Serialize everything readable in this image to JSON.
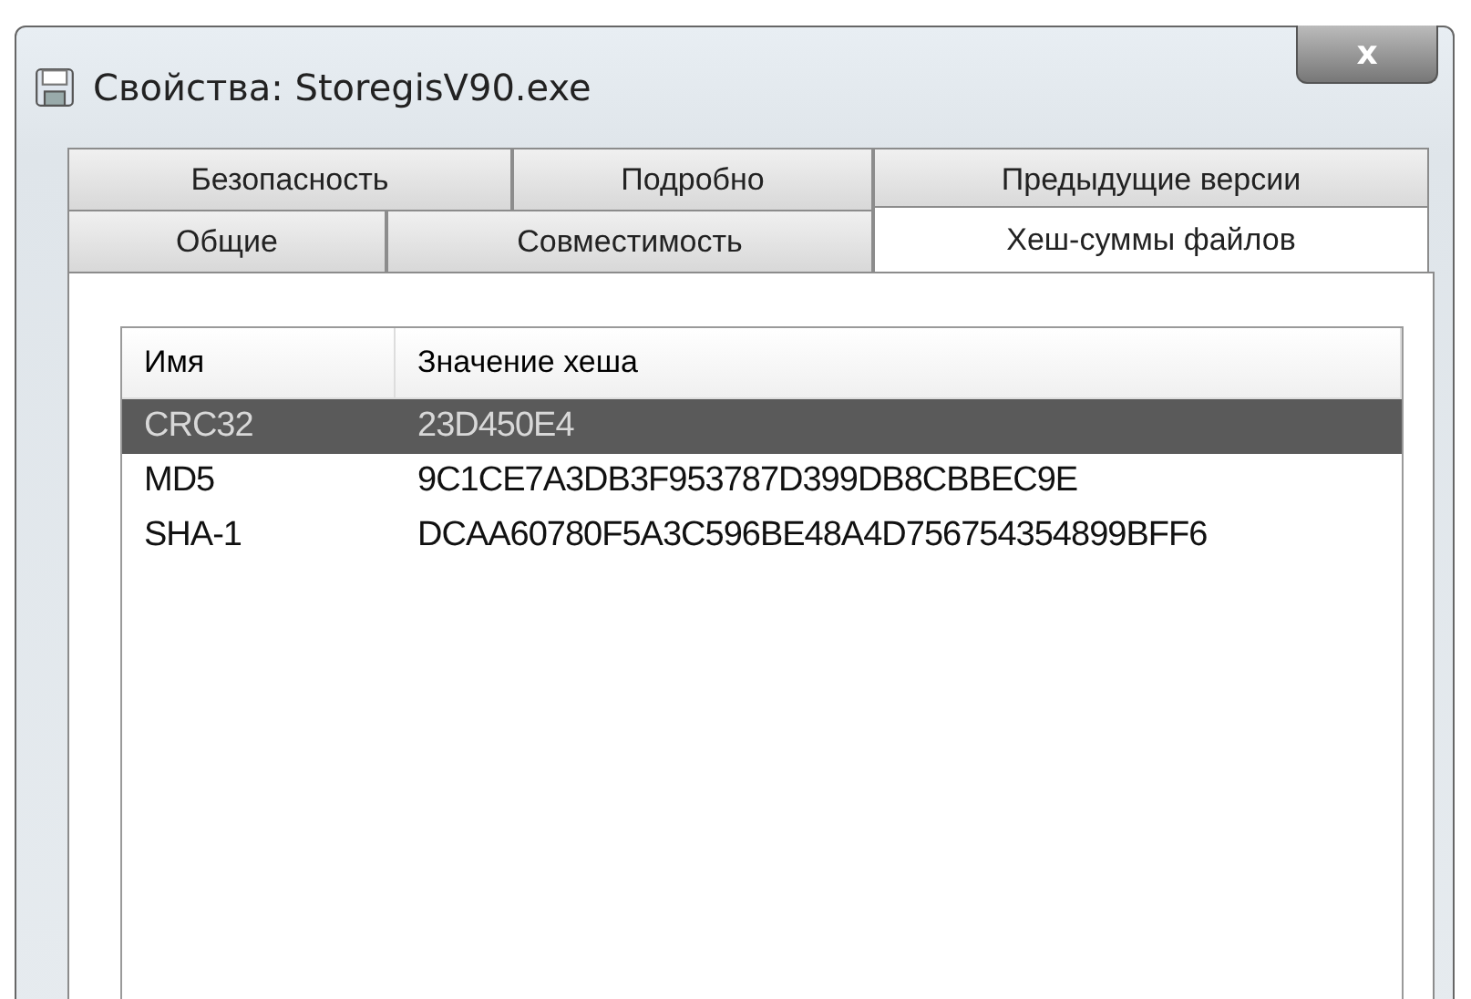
{
  "window": {
    "title": "Свойства: StoregisV90.exe",
    "close": "x"
  },
  "tab_rows": [
    [
      {
        "label": "Безопасность",
        "selected": false
      },
      {
        "label": "Подробно",
        "selected": false
      },
      {
        "label": "Предыдущие версии",
        "selected": false
      }
    ],
    [
      {
        "label": "Общие",
        "selected": false
      },
      {
        "label": "Совместимость",
        "selected": false
      },
      {
        "label": "Хеш-суммы файлов",
        "selected": true
      }
    ]
  ],
  "table": {
    "columns": [
      "Имя",
      "Значение хеша"
    ],
    "rows": [
      {
        "name": "CRC32",
        "value": "23D450E4",
        "selected": true
      },
      {
        "name": "MD5",
        "value": "9C1CE7A3DB3F953787D399DB8CBBEC9E",
        "selected": false
      },
      {
        "name": "SHA-1",
        "value": "DCAA60780F5A3C596BE48A4D756754354899BFF6",
        "selected": false
      }
    ]
  }
}
